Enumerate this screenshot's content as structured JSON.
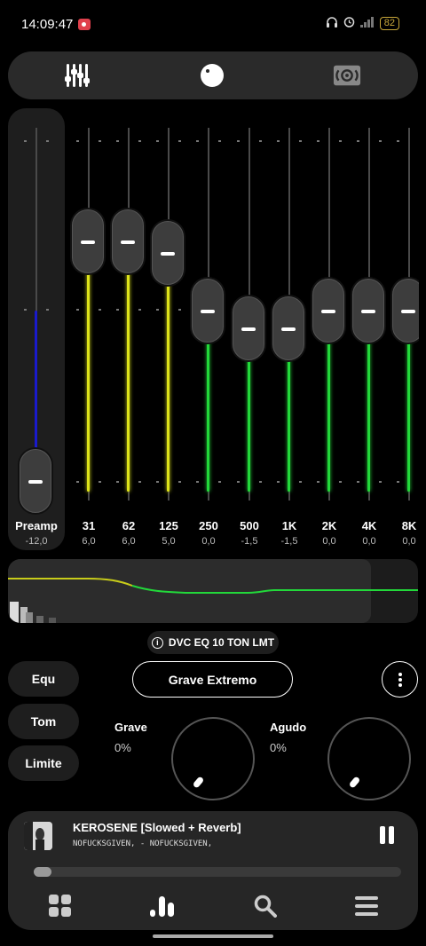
{
  "status_bar": {
    "time": "14:09:47",
    "battery": "82"
  },
  "tabs": [
    {
      "icon": "equalizer-sliders-icon"
    },
    {
      "icon": "knob-icon"
    },
    {
      "icon": "surround-speaker-icon"
    }
  ],
  "preamp": {
    "label": "Preamp",
    "value": "-12,0"
  },
  "bands": [
    {
      "freq": "31",
      "value": "6,0"
    },
    {
      "freq": "62",
      "value": "6,0"
    },
    {
      "freq": "125",
      "value": "5,0"
    },
    {
      "freq": "250",
      "value": "0,0"
    },
    {
      "freq": "500",
      "value": "-1,5"
    },
    {
      "freq": "1K",
      "value": "-1,5"
    },
    {
      "freq": "2K",
      "value": "0,0"
    },
    {
      "freq": "4K",
      "value": "0,0"
    },
    {
      "freq": "8K",
      "value": "0,0"
    }
  ],
  "colors": {
    "positive_fill": "#dde31a",
    "zero_fill": "#22d83a",
    "preamp_fill": "#1a1acc",
    "curve_low": "#c8cc1a",
    "curve_high": "#22d83a"
  },
  "preset_chip": {
    "text": "DVC EQ 10 TON LMT"
  },
  "side_buttons": {
    "equ": "Equ",
    "tom": "Tom",
    "limite": "Limite"
  },
  "preset_button": {
    "label": "Grave Extremo"
  },
  "dials": {
    "grave": {
      "label": "Grave",
      "value": "0%"
    },
    "agudo": {
      "label": "Agudo",
      "value": "0%"
    }
  },
  "player": {
    "song": "KEROSENE [Slowed + Reverb]",
    "artist": "NOFUCKSGIVEN, - NOFUCKSGIVEN,"
  },
  "bottom_nav": [
    {
      "icon": "grid-icon"
    },
    {
      "icon": "equalizer-bars-icon"
    },
    {
      "icon": "search-icon"
    },
    {
      "icon": "menu-icon"
    }
  ]
}
